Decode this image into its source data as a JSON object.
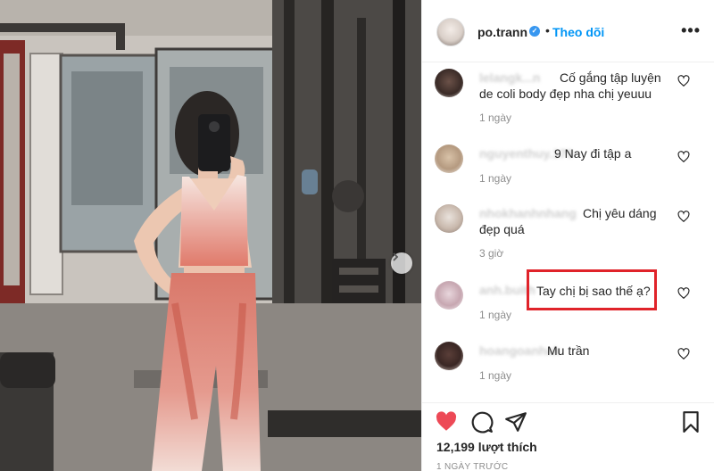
{
  "post": {
    "username": "po.trann",
    "verified_icon": "verified-badge-icon",
    "separator": "•",
    "follow_label": "Theo dõi",
    "more_icon": "more-options-icon",
    "more_label": "•••"
  },
  "comments": [
    {
      "user": "lelangk...n",
      "text_line1": "Cố gắng tập luyện",
      "text_line2": "de coli body đẹp nha chị yeuuu",
      "time": "1 ngày"
    },
    {
      "user": "nguyenthuy.179",
      "text": "9 Nay đi tập a",
      "time": "1 ngày"
    },
    {
      "user": "nhokhanhnhang",
      "text_line1": "Chị yêu dáng",
      "text_line2": "đẹp quá",
      "time": "3 giờ"
    },
    {
      "user": "anh.buith",
      "text": "Tay chị bị sao thế ạ?",
      "time": "1 ngày"
    },
    {
      "user": "hoangoanhak",
      "text": "Mu trần",
      "time": "1 ngày"
    }
  ],
  "actions": {
    "like_icon": "heart-filled-icon",
    "comment_icon": "comment-icon",
    "share_icon": "share-icon",
    "save_icon": "bookmark-icon"
  },
  "likes_label": "12,199 lượt thích",
  "post_age": "1 NGÀY TRƯỚC",
  "colors": {
    "accent": "#0095f6",
    "like_red": "#ed4956",
    "highlight_red": "#e0232a",
    "muted": "#8e8e8e"
  }
}
